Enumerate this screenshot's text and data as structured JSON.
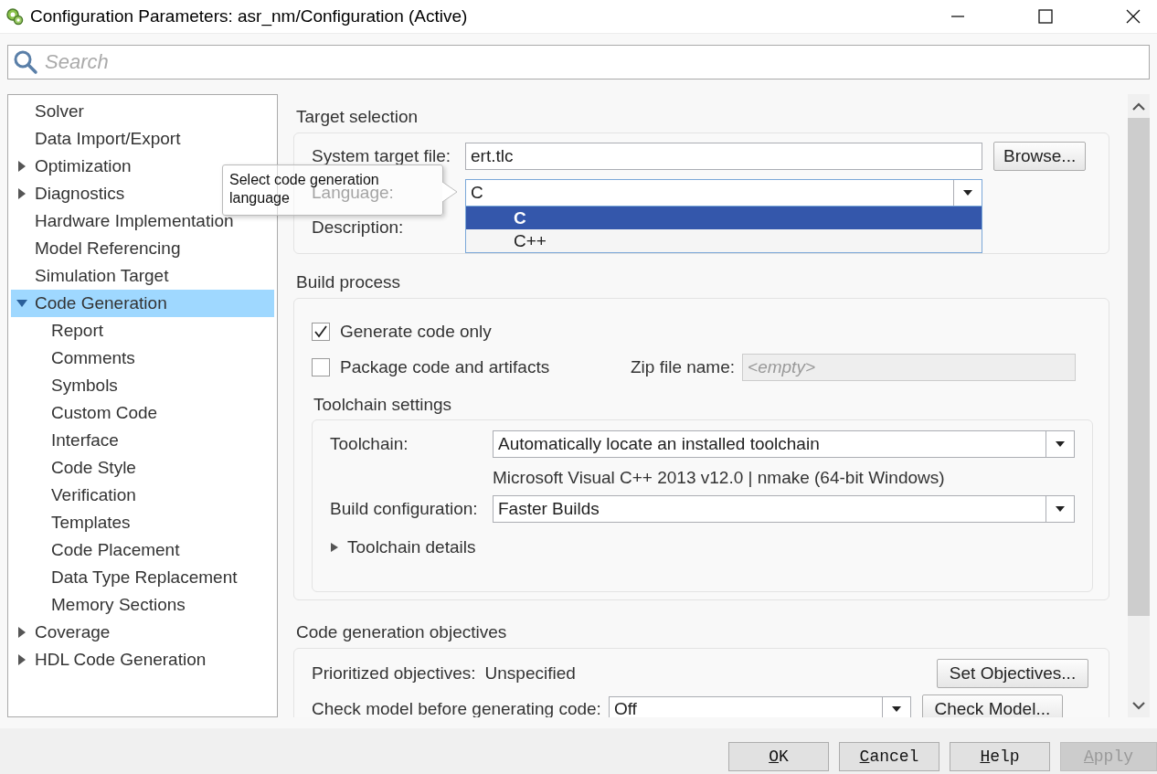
{
  "window": {
    "title": "Configuration Parameters: asr_nm/Configuration (Active)"
  },
  "search": {
    "placeholder": "Search"
  },
  "tree": [
    {
      "label": "Solver",
      "selected": false
    },
    {
      "label": "Data Import/Export",
      "selected": false
    },
    {
      "label": "Optimization",
      "selected": false,
      "expanded": false
    },
    {
      "label": "Diagnostics",
      "selected": false,
      "expanded": false
    },
    {
      "label": "Hardware Implementation",
      "selected": false
    },
    {
      "label": "Model Referencing",
      "selected": false
    },
    {
      "label": "Simulation Target",
      "selected": false
    },
    {
      "label": "Code Generation",
      "selected": true,
      "expanded": true,
      "children": [
        {
          "label": "Report",
          "selected": false
        },
        {
          "label": "Comments",
          "selected": false
        },
        {
          "label": "Symbols",
          "selected": false
        },
        {
          "label": "Custom Code",
          "selected": false
        },
        {
          "label": "Interface",
          "selected": false
        },
        {
          "label": "Code Style",
          "selected": false
        },
        {
          "label": "Verification",
          "selected": false
        },
        {
          "label": "Templates",
          "selected": false
        },
        {
          "label": "Code Placement",
          "selected": false
        },
        {
          "label": "Data Type Replacement",
          "selected": false
        },
        {
          "label": "Memory Sections",
          "selected": false
        }
      ]
    },
    {
      "label": "Coverage",
      "selected": false,
      "expanded": false
    },
    {
      "label": "HDL Code Generation",
      "selected": false,
      "expanded": false
    }
  ],
  "target_selection": {
    "title": "Target selection",
    "system_target_file": {
      "label": "System target file:",
      "value": "ert.tlc"
    },
    "browse_button": "Browse...",
    "language": {
      "label": "Language:",
      "value": "C",
      "expanded": true,
      "options": [
        {
          "label": "C",
          "selected": true
        },
        {
          "label": "C++",
          "selected": false
        }
      ]
    },
    "description": {
      "label": "Description:"
    }
  },
  "tooltip": "Select code generation language",
  "build_process": {
    "title": "Build process",
    "checkboxes": [
      {
        "label": "Generate code only",
        "checked": true
      },
      {
        "label": "Package code and artifacts",
        "checked": false
      }
    ],
    "zip_file": {
      "label": "Zip file name:",
      "placeholder": "<empty>",
      "disabled": true
    },
    "toolchain_settings": {
      "title": "Toolchain settings",
      "toolchain": {
        "label": "Toolchain:",
        "value": "Automatically locate an installed toolchain"
      },
      "toolchain_info": "Microsoft Visual C++ 2013 v12.0 | nmake (64-bit Windows)",
      "build_configuration": {
        "label": "Build configuration:",
        "value": "Faster Builds"
      },
      "details": {
        "label": "Toolchain details",
        "expanded": false
      }
    }
  },
  "objectives": {
    "title": "Code generation objectives",
    "prioritized": {
      "label": "Prioritized objectives:",
      "value": "Unspecified"
    },
    "set_button": "Set Objectives...",
    "check_model": {
      "label": "Check model before generating code:",
      "value": "Off"
    },
    "check_button": "Check Model..."
  },
  "buttons": [
    {
      "label": "OK",
      "disabled": false
    },
    {
      "label": "Cancel",
      "disabled": false
    },
    {
      "label": "Help",
      "disabled": false
    },
    {
      "label": "Apply",
      "disabled": true
    }
  ]
}
